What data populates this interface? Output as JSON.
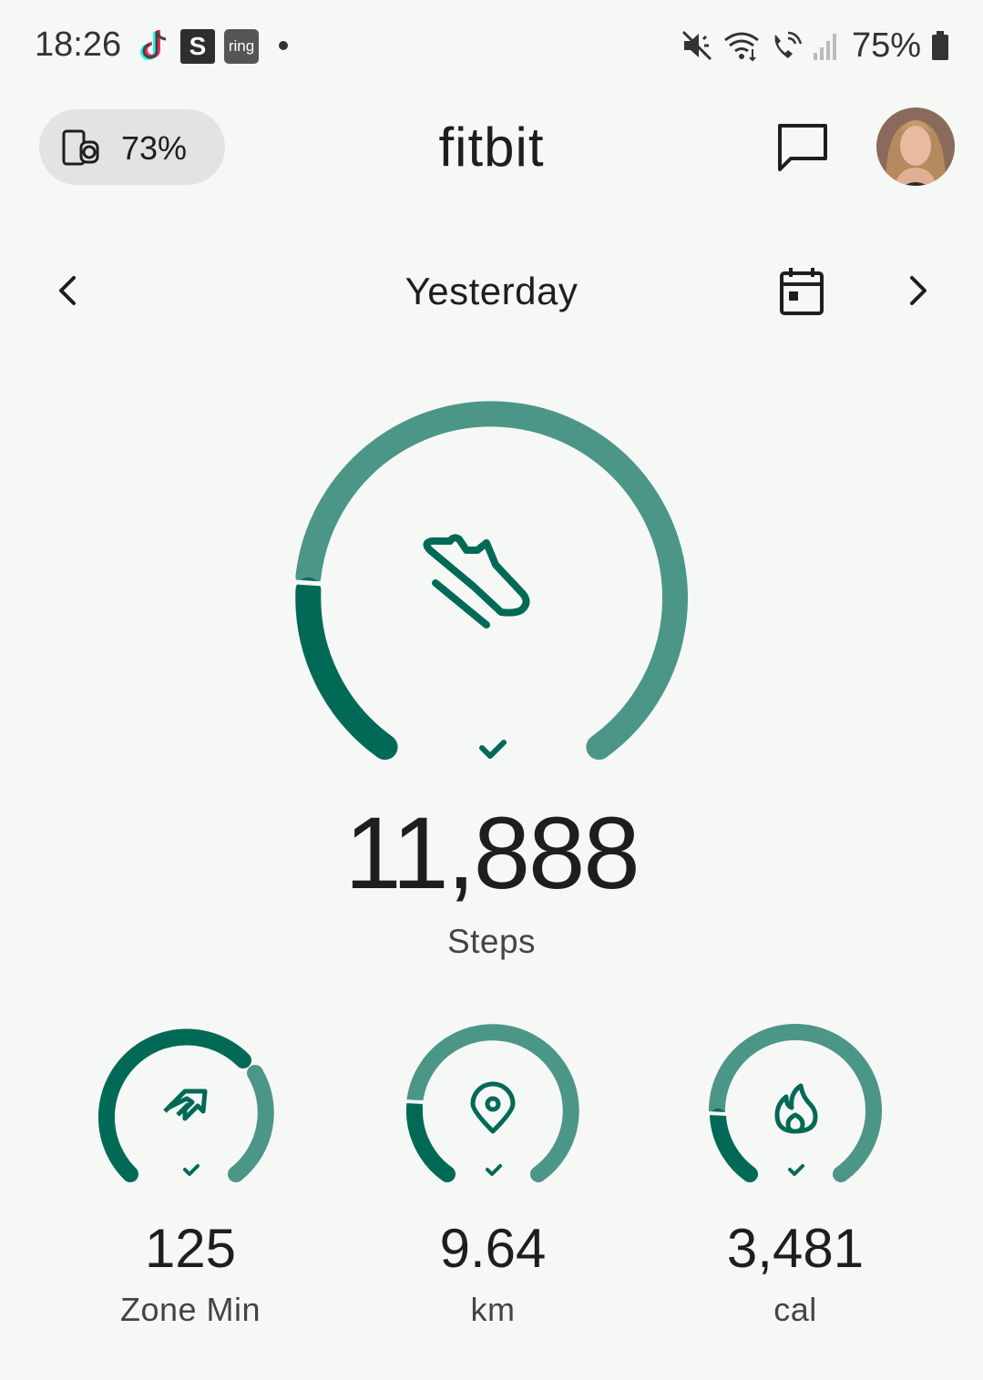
{
  "status_bar": {
    "time": "18:26",
    "s_badge": "S",
    "ring_badge": "ring",
    "battery": "75%"
  },
  "header": {
    "device_battery": "73%",
    "app_title": "fitbit"
  },
  "date_nav": {
    "label": "Yesterday"
  },
  "main_stat": {
    "value": "11,888",
    "label": "Steps",
    "goal_met": true,
    "icon": "shoe-icon"
  },
  "stats": [
    {
      "value": "125",
      "label": "Zone Min",
      "icon": "zone-minutes-icon",
      "goal_met": true
    },
    {
      "value": "9.64",
      "label": "km",
      "icon": "location-pin-icon",
      "goal_met": true
    },
    {
      "value": "3,481",
      "label": "cal",
      "icon": "flame-icon",
      "goal_met": true
    }
  ],
  "colors": {
    "accent_dark": "#006a57",
    "accent_light": "#4c9687",
    "background": "#f6f8f6"
  }
}
